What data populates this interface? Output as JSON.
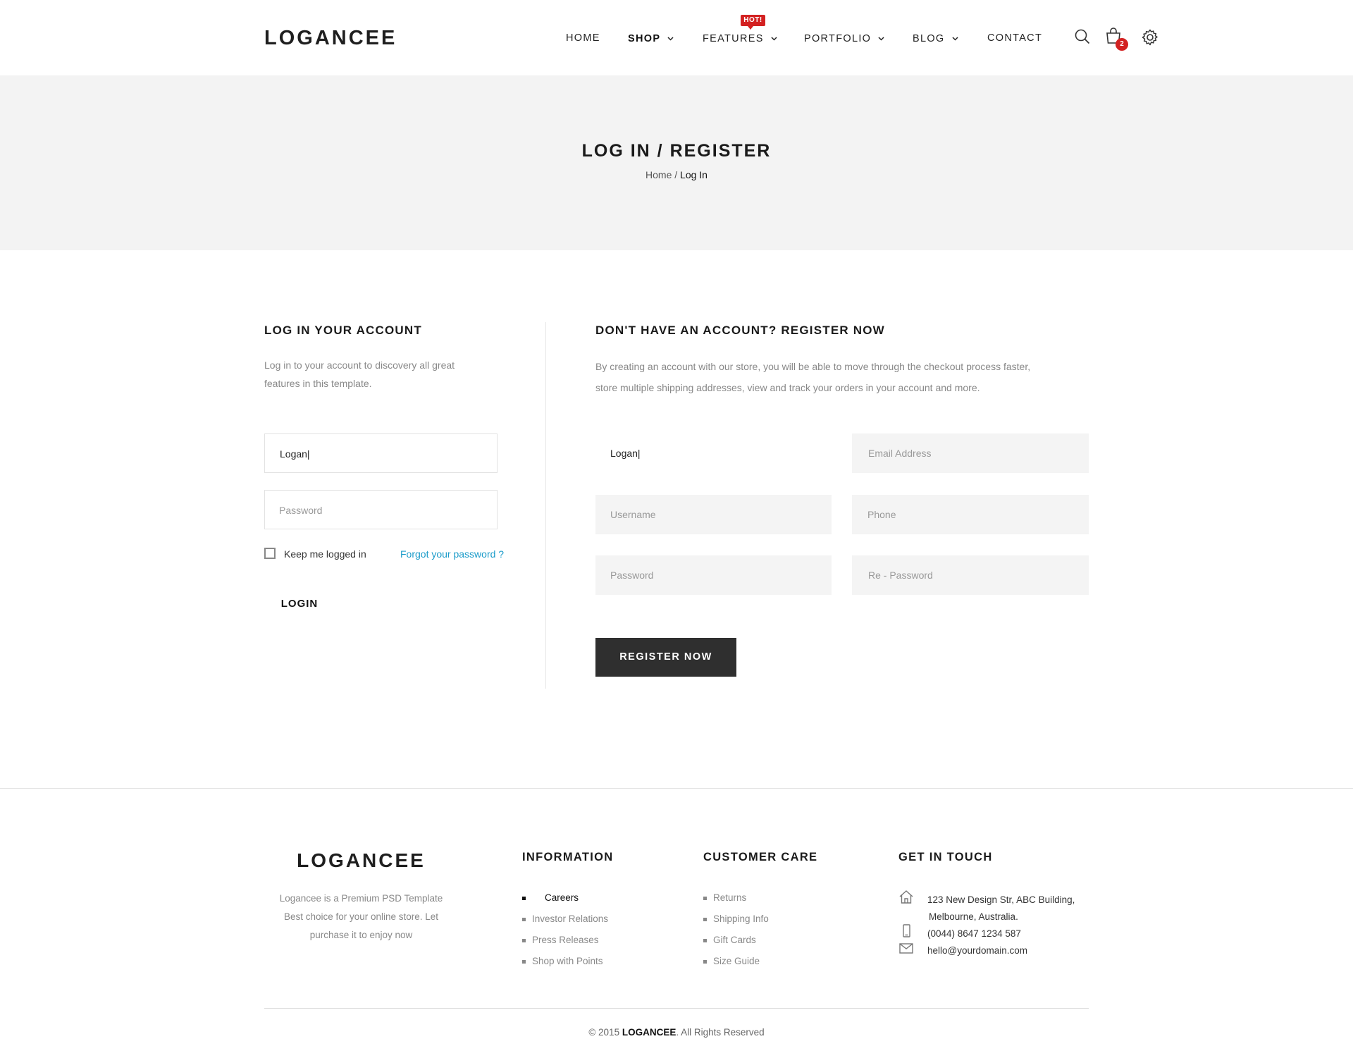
{
  "brand": "LOGANCEE",
  "nav": {
    "items": [
      {
        "label": "HOME"
      },
      {
        "label": "SHOP"
      },
      {
        "label": "FEATURES"
      },
      {
        "label": "PORTFOLIO"
      },
      {
        "label": "BLOG"
      },
      {
        "label": "CONTACT"
      }
    ],
    "hot_badge": "HOT!",
    "cart_count": "2",
    "icons": [
      "search-icon",
      "shopping-bag-icon",
      "gear-icon"
    ],
    "accent_color": "#d32121"
  },
  "hero": {
    "title": "LOG IN / REGISTER",
    "breadcrumb_home": "Home",
    "breadcrumb_sep": " / ",
    "breadcrumb_current": "Log In"
  },
  "login": {
    "title": "LOG IN YOUR ACCOUNT",
    "desc_line1": "Log in to your account to discovery all great",
    "desc_line2": "features in this template.",
    "username_value": "Logan|",
    "password_placeholder": "Password",
    "keep_label": "Keep me logged in",
    "forgot_label": "Forgot your password ?",
    "button": "LOGIN",
    "link_color": "#1a9bc9"
  },
  "register": {
    "title": "DON'T HAVE AN ACCOUNT? REGISTER NOW",
    "desc_line1": "By creating an account with our store, you will be able to move through the checkout process faster,",
    "desc_line2": "store multiple shipping addresses, view and track your orders in your account and more.",
    "name_value": "Logan|",
    "email_placeholder": "Email Address",
    "username_placeholder": "Username",
    "phone_placeholder": "Phone",
    "password_placeholder": "Password",
    "repassword_placeholder": "Re - Password",
    "button": "REGISTER NOW"
  },
  "footer": {
    "logo": "LOGANCEE",
    "about_line1": "Logancee is a Premium PSD Template",
    "about_line2": "Best choice for your online store. Let",
    "about_line3": "purchase it to enjoy now",
    "information": {
      "title": "INFORMATION",
      "items": [
        "Careers",
        "Investor Relations",
        "Press Releases",
        "Shop with Points"
      ]
    },
    "customer_care": {
      "title": "CUSTOMER CARE",
      "items": [
        "Returns",
        "Shipping Info",
        "Gift Cards",
        "Size Guide"
      ]
    },
    "contact": {
      "title": "GET IN TOUCH",
      "address_line1": "123 New Design Str, ABC Building,",
      "address_line2": "Melbourne, Australia.",
      "phone": "(0044) 8647 1234 587",
      "email": "hello@yourdomain.com"
    },
    "copyright_prefix": "© 2015 ",
    "copyright_brand": "LOGANCEE",
    "copyright_suffix": ". All Rights Reserved"
  }
}
